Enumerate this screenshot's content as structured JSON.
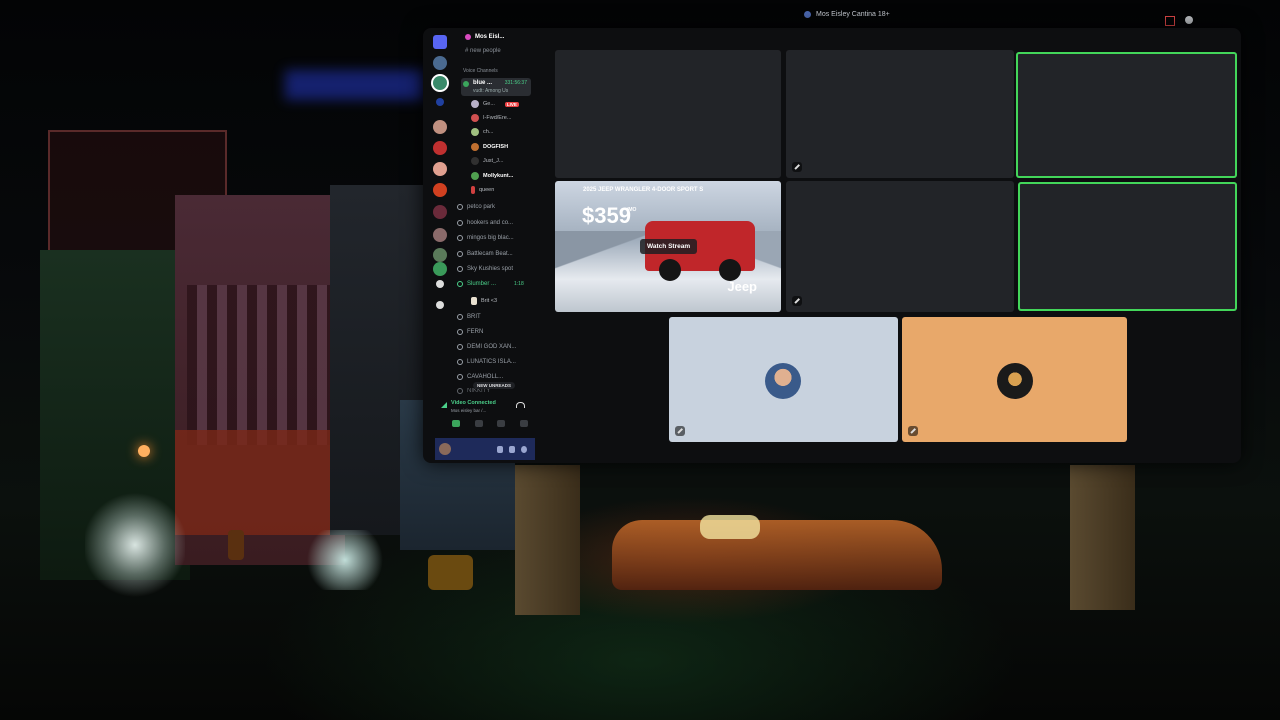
{
  "window": {
    "title": "Mos Eisley Cantina 18+"
  },
  "server": {
    "name": "Mos Eisl...",
    "top_channel": "new people",
    "voice_section": "Voice Channels"
  },
  "active_channel": {
    "name": "blue ...",
    "timer": "331:56:37",
    "activity": "vudt: Among Us"
  },
  "members": [
    {
      "name": "Ge...",
      "badge": "LIVE",
      "color": "#b8b0c8",
      "bold": false
    },
    {
      "name": "I-Fwd/Ere...",
      "badge": "",
      "color": "#d05050",
      "bold": false
    },
    {
      "name": "ch...",
      "badge": "",
      "color": "#a0c080",
      "bold": false
    },
    {
      "name": "DOGFISH",
      "badge": "",
      "color": "#c07030",
      "bold": true
    },
    {
      "name": "Just_J...",
      "badge": "",
      "color": "#303030",
      "bold": false
    },
    {
      "name": "Mollykunt...",
      "badge": "",
      "color": "#50a050",
      "bold": true
    },
    {
      "name": "queen",
      "badge": "",
      "color": "#d04040",
      "bold": false
    }
  ],
  "channels": [
    {
      "name": "petco park"
    },
    {
      "name": "hookers and co..."
    },
    {
      "name": "mingos big blac..."
    },
    {
      "name": "Battlecam Beat..."
    },
    {
      "name": "Sky Kushies spot"
    }
  ],
  "slumber": {
    "name": "Slumber ...",
    "time": "1:18",
    "member": "Brit <3"
  },
  "more_channels": [
    {
      "name": "BRIT"
    },
    {
      "name": "FERN"
    },
    {
      "name": "DEMI GOD XAN..."
    },
    {
      "name": "LUNATICS ISLA..."
    },
    {
      "name": "CAVAHOLL..."
    },
    {
      "name": "NIKKITY"
    }
  ],
  "new_unreads": "NEW UNREADS",
  "voice_connection": {
    "status": "Video Connected",
    "location": "Mos eisley bar /..."
  },
  "stream": {
    "headline": "2025 JEEP WRANGLER 4-DOOR SPORT S",
    "price": "$359",
    "per": "/MO",
    "brand": "Jeep",
    "watch_label": "Watch Stream"
  },
  "colors": {
    "speaking": "#43d65a",
    "tile_light": "#c8d2de",
    "tile_orange": "#e8a86a",
    "user_bar": "#1e2a5a"
  }
}
